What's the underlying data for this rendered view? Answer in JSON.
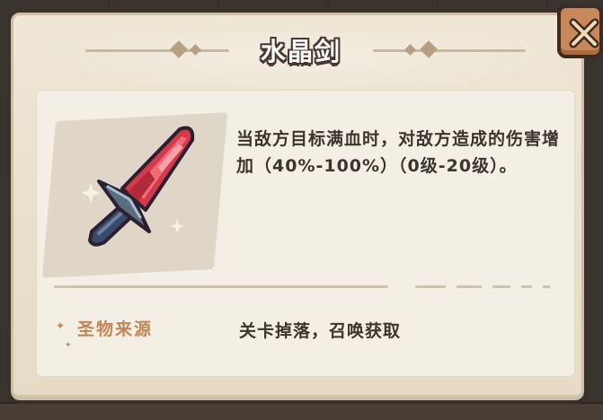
{
  "item": {
    "title": "水晶剑",
    "description": "当敌方目标满血时，对敌方造成的伤害增加（40%-100%）（0级-20级）。",
    "icon": "crystal-sword-icon"
  },
  "source": {
    "label": "圣物来源",
    "value": "关卡掉落，召唤获取"
  },
  "close": {
    "icon": "close-x-icon"
  },
  "colors": {
    "parchment": "#efe6d6",
    "frame": "#3b312b",
    "accent_label": "#c08658",
    "close_button": "#c9885a",
    "crystal": "#d63a4a"
  }
}
